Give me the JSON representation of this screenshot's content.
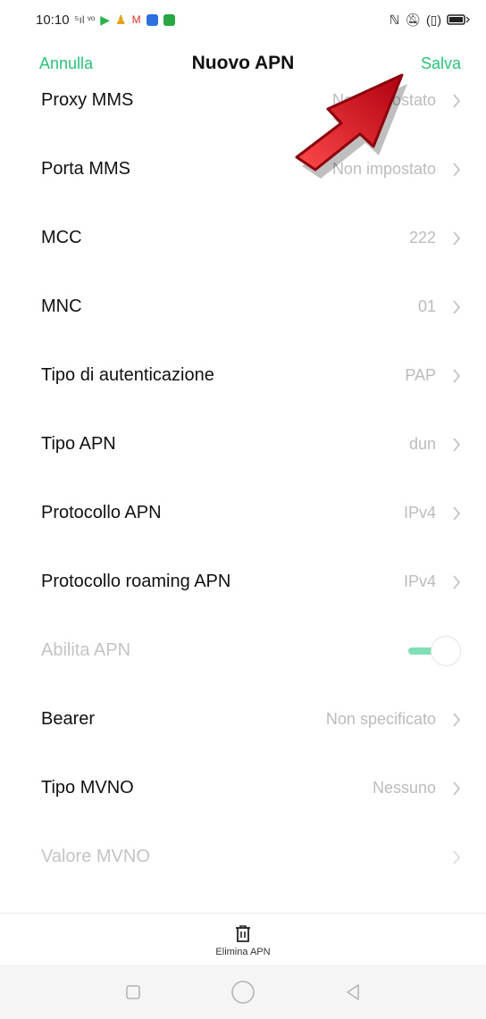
{
  "status_bar": {
    "time": "10:10",
    "signal": "⁵ıl ᵛᵒ",
    "battery_icon": "battery-icon"
  },
  "header": {
    "cancel": "Annulla",
    "title": "Nuovo APN",
    "save": "Salva",
    "accent": "#2bc27a"
  },
  "rows": [
    {
      "label": "Proxy MMS",
      "value": "Non impostato"
    },
    {
      "label": "Porta MMS",
      "value": "Non impostato"
    },
    {
      "label": "MCC",
      "value": "222"
    },
    {
      "label": "MNC",
      "value": "01"
    },
    {
      "label": "Tipo di autenticazione",
      "value": "PAP"
    },
    {
      "label": "Tipo APN",
      "value": "dun"
    },
    {
      "label": "Protocollo APN",
      "value": "IPv4"
    },
    {
      "label": "Protocollo roaming APN",
      "value": "IPv4"
    },
    {
      "label": "Abilita APN",
      "value": ""
    },
    {
      "label": "Bearer",
      "value": "Non specificato"
    },
    {
      "label": "Tipo MVNO",
      "value": "Nessuno"
    },
    {
      "label": "Valore MVNO",
      "value": ""
    }
  ],
  "toggle_abilita_apn": "on (disabled)",
  "footer": {
    "delete_label": "Elimina APN"
  },
  "annotation_arrow_color": "#e3141b"
}
